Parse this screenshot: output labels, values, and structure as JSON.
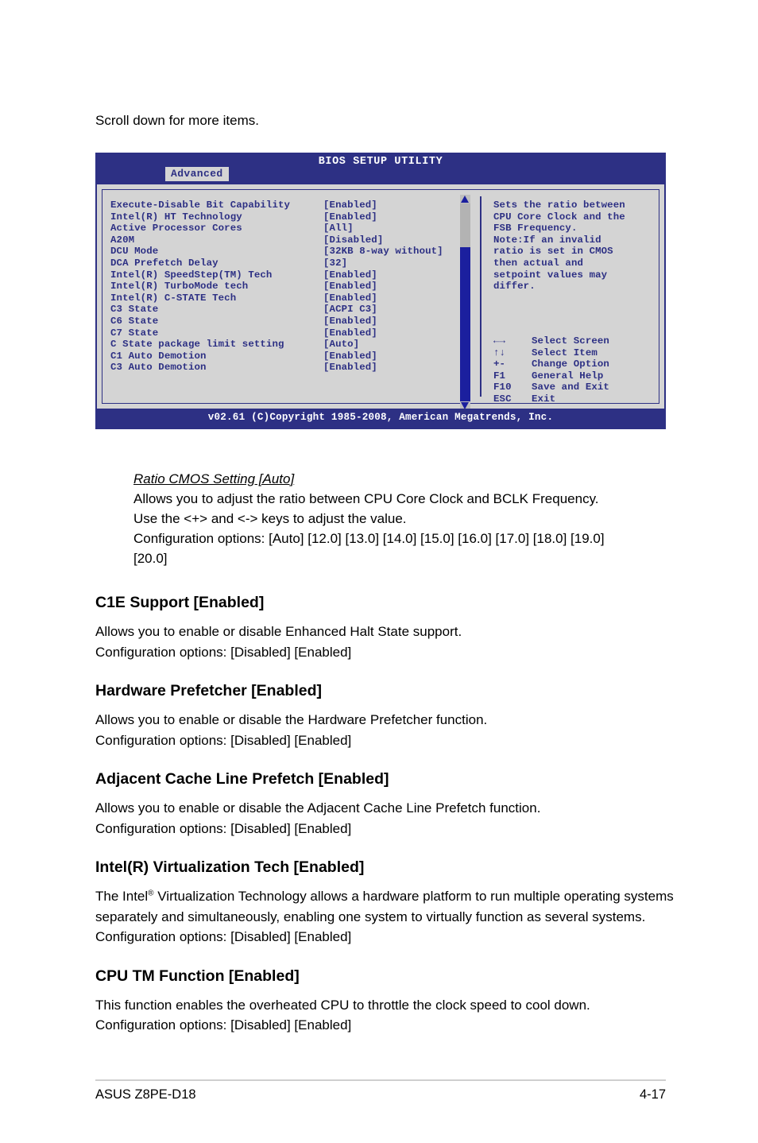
{
  "document": {
    "intro_line": "Scroll down for more items.",
    "footer_left": "ASUS Z8PE-D18",
    "footer_right": "4-17"
  },
  "bios": {
    "title": "BIOS SETUP UTILITY",
    "active_tab": "Advanced",
    "footer": "v02.61 (C)Copyright 1985-2008, American Megatrends, Inc.",
    "colors": {
      "chrome_blue": "#2d3084",
      "panel_grey": "#d4d4d4",
      "text_blue": "#2d3084",
      "scroll_track": "#1b1f9e",
      "scroll_thumb": "#b3b3b3"
    },
    "settings": [
      {
        "name": "Execute-Disable Bit Capability",
        "value": "[Enabled]"
      },
      {
        "name": "Intel(R) HT Technology",
        "value": "[Enabled]"
      },
      {
        "name": "Active Processor Cores",
        "value": "[All]"
      },
      {
        "name": "A20M",
        "value": "[Disabled]"
      },
      {
        "name": "DCU Mode",
        "value": "[32KB 8-way without]"
      },
      {
        "name": "DCA Prefetch Delay",
        "value": "[32]"
      },
      {
        "name": "Intel(R) SpeedStep(TM) Tech",
        "value": "[Enabled]"
      },
      {
        "name": "Intel(R) TurboMode tech",
        "value": "[Enabled]"
      },
      {
        "name": "Intel(R) C-STATE Tech",
        "value": "[Enabled]"
      },
      {
        "name": "C3 State",
        "value": "[ACPI C3]"
      },
      {
        "name": "C6 State",
        "value": "[Enabled]"
      },
      {
        "name": "C7 State",
        "value": "[Enabled]"
      },
      {
        "name": "C State package limit setting",
        "value": "[Auto]"
      },
      {
        "name": "C1 Auto Demotion",
        "value": "[Enabled]"
      },
      {
        "name": "C3 Auto Demotion",
        "value": "[Enabled]"
      }
    ],
    "help_lines": [
      "Sets the ratio between",
      "CPU Core Clock and the",
      "FSB Frequency.",
      "Note:If an invalid",
      "ratio is set in CMOS",
      "then actual and",
      "setpoint values may",
      "differ."
    ],
    "legend": [
      {
        "key": "←→",
        "desc": "Select Screen"
      },
      {
        "key": "↑↓",
        "desc": "Select Item"
      },
      {
        "key": "+-",
        "desc": "Change Option"
      },
      {
        "key": "F1",
        "desc": "General Help"
      },
      {
        "key": "F10",
        "desc": "Save and Exit"
      },
      {
        "key": "ESC",
        "desc": "Exit"
      }
    ],
    "scrollbar": {
      "up_arrow": "scroll-up-arrow",
      "down_arrow": "scroll-down-arrow",
      "thumb_position": "top"
    }
  },
  "ratio_block": {
    "heading": "Ratio CMOS Setting [Auto]",
    "lines": [
      "Allows you to adjust the ratio between CPU Core Clock and BCLK Frequency.",
      "Use the <+> and <-> keys to adjust the value.",
      "Configuration options: [Auto] [12.0] [13.0] [14.0] [15.0] [16.0] [17.0] [18.0] [19.0]",
      "[20.0]"
    ]
  },
  "sections": [
    {
      "heading": "C1E Support [Enabled]",
      "body": "Allows you to enable or disable Enhanced Halt State support.\nConfiguration options: [Disabled] [Enabled]"
    },
    {
      "heading": "Hardware Prefetcher [Enabled]",
      "body": "Allows you to enable or disable the Hardware Prefetcher function.\nConfiguration options: [Disabled] [Enabled]"
    },
    {
      "heading": "Adjacent Cache Line Prefetch [Enabled]",
      "body": "Allows you to enable or disable the Adjacent Cache Line Prefetch function.\nConfiguration options: [Disabled] [Enabled]"
    },
    {
      "heading": "Intel(R) Virtualization Tech [Enabled]",
      "body_pre": "The Intel",
      "body_sup": "®",
      "body_post": " Virtualization Technology allows a hardware platform to run multiple operating systems separately and simultaneously, enabling one system to virtually function as several systems. Configuration options: [Disabled] [Enabled]"
    },
    {
      "heading": "CPU TM Function [Enabled]",
      "body": "This function enables the overheated CPU to throttle the clock speed to cool down.\nConfiguration options: [Disabled] [Enabled]"
    }
  ]
}
